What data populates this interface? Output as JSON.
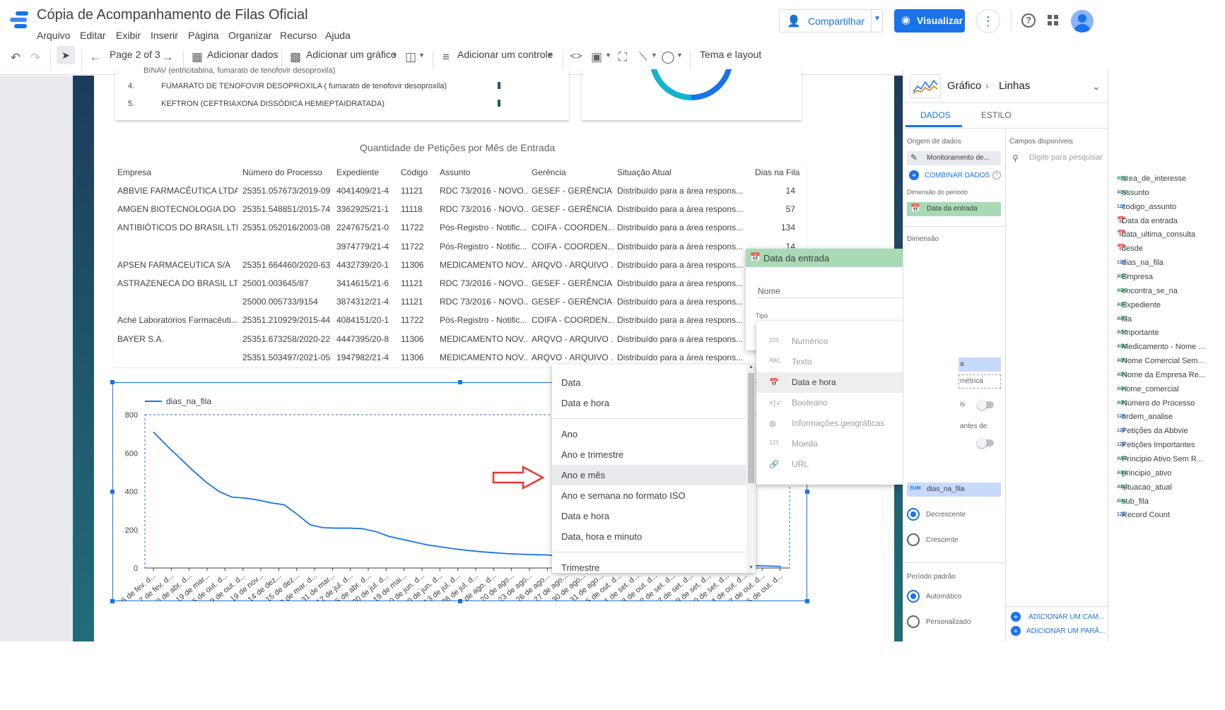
{
  "header": {
    "title": "Cópia de Acompanhamento de Filas Oficial",
    "menu": [
      "Arquivo",
      "Editar",
      "Exibir",
      "Inserir",
      "Página",
      "Organizar",
      "Recurso",
      "Ajuda"
    ],
    "share_label": "Compartilhar",
    "view_label": "Visualizar"
  },
  "toolbar": {
    "page_label": "Page 2 of 3",
    "add_data": "Adicionar dados",
    "add_chart": "Adicionar um gráfico",
    "add_control": "Adicionar um controle",
    "theme": "Tema e layout"
  },
  "top_list": {
    "items": [
      {
        "n": "4.",
        "text": "FUMARATO DE TENOFOVIR DESOPROXILA ( fumarato de tenofovir desoproxila)"
      },
      {
        "n": "5.",
        "text": "KEFTRON (CEFTRIAXONA DISSÓDICA HEMIEPTAIDRATADA)"
      }
    ]
  },
  "table": {
    "title": "Quantidade de Petições por Mês de Entrada",
    "headers": [
      "Empresa",
      "Número do Processo",
      "Expediente",
      "Código",
      "Assunto",
      "Gerência",
      "Situação Atual",
      "Dias na Fila"
    ],
    "rows": [
      [
        "ABBVIE FARMACÊUTICA LTDA.",
        "25351.057673/2019-09",
        "4041409/21-4",
        "11121",
        "RDC 73/2016 - NOVO...",
        "GESEF - GERÊNCIA ...",
        "Distribuído para a área respons...",
        "14"
      ],
      [
        "AMGEN BIOTECNOLOGIA DO ...",
        "25351.548851/2015-74",
        "3362925/21-1",
        "11118",
        "RDC 73/2016 - NOVO...",
        "GESEF - GERÊNCIA ...",
        "Distribuído para a área respons...",
        "57"
      ],
      [
        "ANTIBIÓTICOS DO BRASIL LTDA",
        "25351.052016/2003-08",
        "2247675/21-0",
        "11722",
        "Pós-Registro - Notific...",
        "COIFA - COORDEN...",
        "Distribuído para a área respons...",
        "134"
      ],
      [
        "",
        "",
        "3974779/21-4",
        "11722",
        "Pós-Registro - Notific...",
        "COIFA - COORDEN...",
        "Distribuído para a área respons...",
        "14"
      ],
      [
        "APSEN FARMACEUTICA S/A",
        "25351.664460/2020-63",
        "4432739/20-1",
        "11306",
        "MEDICAMENTO NOV...",
        "ARQVO - ARQUIVO ...",
        "Distribuído para a área respons...",
        ""
      ],
      [
        "ASTRAZENECA DO BRASIL LTDA",
        "25001.003645/87",
        "3414615/21-6",
        "11121",
        "RDC 73/2016 - NOVO...",
        "GESEF - GERÊNCIA ...",
        "Distribuído para a área respons...",
        ""
      ],
      [
        "",
        "25000.005733/9154",
        "3874312/21-4",
        "11121",
        "RDC 73/2016 - NOVO...",
        "GESEF - GERÊNCIA ...",
        "Distribuído para a área respons...",
        ""
      ],
      [
        "Aché Laboratórios Farmacêuti...",
        "25351.210929/2015-44",
        "4084151/20-1",
        "11722",
        "Pós-Registro - Notific...",
        "COIFA - COORDEN...",
        "Distribuído para a área respons...",
        ""
      ],
      [
        "BAYER S.A.",
        "25351.673258/2020-22",
        "4447395/20-8",
        "11306",
        "MEDICAMENTO NOV...",
        "ARQVO - ARQUIVO ...",
        "Distribuído para a área respons...",
        ""
      ],
      [
        "",
        "25351.503497/2021-05",
        "1947982/21-4",
        "11306",
        "MEDICAMENTO NOV...",
        "ARQVO - ARQUIVO ...",
        "Distribuído para a área respons...",
        ""
      ]
    ]
  },
  "chart_data": {
    "type": "line",
    "series": [
      {
        "name": "dias_na_fila",
        "values": [
          710,
          640,
          575,
          510,
          450,
          400,
          370,
          365,
          355,
          340,
          330,
          280,
          225,
          210,
          208,
          208,
          205,
          190,
          165,
          150,
          135,
          120,
          110,
          100,
          92,
          85,
          80,
          75,
          72,
          70,
          68,
          65,
          60,
          55,
          50,
          45,
          40,
          35,
          30,
          27,
          25,
          22,
          20,
          18,
          16,
          14,
          12,
          10,
          8
        ]
      }
    ],
    "ylim": [
      0,
      800
    ],
    "yticks": [
      "0",
      "200",
      "400",
      "600",
      "800"
    ],
    "xticks": [
      "26 de fev. d...",
      "17 de fev. d...",
      "30 de abr. d...",
      "19 de mar...",
      "16 de out. d...",
      "29 de out. d...",
      "19 de nov...",
      "14 de dez...",
      "15 de dez...",
      "8 de mar. d...",
      "31 de mar...",
      "12 de jul. d...",
      "5 de abr. d...",
      "30 de jul. d...",
      "19 de mai...",
      "10 de jun. d...",
      "30 de jun. d...",
      "13 de jul. d...",
      "28 de jul. d...",
      "6 de ago. d...",
      "20 de ago...",
      "23 de ago...",
      "26 de ago...",
      "27 de ago...",
      "30 de ago...",
      "31 de ago...",
      "5 de out. d...",
      "1 de set. d...",
      "8 de out. d...",
      "22 de set. d...",
      "27 de set. d...",
      "29 de set. d...",
      "30 de set. d...",
      "4 de out. d...",
      "7 de out. d...",
      "15 de out. d..."
    ]
  },
  "format_menu": {
    "items": [
      "Data",
      "Data e hora",
      "Ano",
      "Ano e trimestre",
      "Ano e mês",
      "Ano e semana no formato ISO",
      "Data e hora",
      "Data, hora e minuto",
      "Trimestre"
    ]
  },
  "type_menu": {
    "items": [
      {
        "tag": "123",
        "label": "Numérico",
        "arrow": true
      },
      {
        "tag": "ABC",
        "label": "Texto",
        "arrow": false
      },
      {
        "tag": "cal",
        "label": "Data e hora",
        "arrow": true
      },
      {
        "tag": "bool",
        "label": "Booleano",
        "arrow": false
      },
      {
        "tag": "geo",
        "label": "Informações geográficas",
        "arrow": true
      },
      {
        "tag": "123",
        "label": "Moeda",
        "arrow": true
      },
      {
        "tag": "link",
        "label": "URL",
        "arrow": true
      }
    ]
  },
  "field_editor": {
    "title": "Data da entrada",
    "name_placeholder": "Nome",
    "type_label": "Tipo"
  },
  "panel": {
    "chart_type": "Gráfico",
    "chart_subtype": "Linhas",
    "tab_data": "DADOS",
    "tab_style": "ESTILO",
    "source_label": "Origem de dados",
    "source_value": "Monitoramento de...",
    "blend_label": "COMBINAR DADOS",
    "period_dim_label": "Dimensão do período",
    "period_dim_value": "Data da entrada",
    "dimension_label": "Dimensão",
    "partial_a": "a",
    "partial_metric": "métrica",
    "partial_is": "is",
    "partial_antes": "antes de",
    "sort_metric": "dias_na_fila",
    "sort_sum": "SUM",
    "desc": "Decrescente",
    "asc": "Crescente",
    "default_period": "Período padrão",
    "auto": "Automático",
    "custom": "Personalizado",
    "available_fields": "Campos disponíveis",
    "search_placeholder": "Digite para pesquisar",
    "fields": [
      {
        "t": "ABC",
        "n": "area_de_interesse"
      },
      {
        "t": "ABC",
        "n": "assunto"
      },
      {
        "t": "123",
        "n": "codigo_assunto"
      },
      {
        "t": "cal",
        "n": "Data da entrada"
      },
      {
        "t": "cal",
        "n": "data_ultima_consulta"
      },
      {
        "t": "cal",
        "n": "desde"
      },
      {
        "t": "123",
        "n": "dias_na_fila"
      },
      {
        "t": "ABC",
        "n": "Empresa"
      },
      {
        "t": "ABC",
        "n": "encontra_se_na"
      },
      {
        "t": "ABC",
        "n": "Expediente"
      },
      {
        "t": "ABC",
        "n": "fila"
      },
      {
        "t": "ABC",
        "n": "Importante"
      },
      {
        "t": "ABC",
        "n": "Medicamento - Nome ..."
      },
      {
        "t": "ABC",
        "n": "Nome Comercial Sem..."
      },
      {
        "t": "ABC",
        "n": "Nome da Empresa Re..."
      },
      {
        "t": "ABC",
        "n": "nome_comercial"
      },
      {
        "t": "ABC",
        "n": "Número do Processo"
      },
      {
        "t": "123",
        "n": "ordem_analise"
      },
      {
        "t": "123",
        "n": "Petições da Abbvie"
      },
      {
        "t": "123",
        "n": "Petições Importantes"
      },
      {
        "t": "ABC",
        "n": "Principio Ativo Sem R..."
      },
      {
        "t": "ABC",
        "n": "principio_ativo"
      },
      {
        "t": "ABC",
        "n": "situacao_atual"
      },
      {
        "t": "ABC",
        "n": "sub_fila"
      },
      {
        "t": "123",
        "n": "Record Count"
      }
    ],
    "add_field": "ADICIONAR UM CAM...",
    "add_param": "ADICIONAR UM PARÂ..."
  }
}
